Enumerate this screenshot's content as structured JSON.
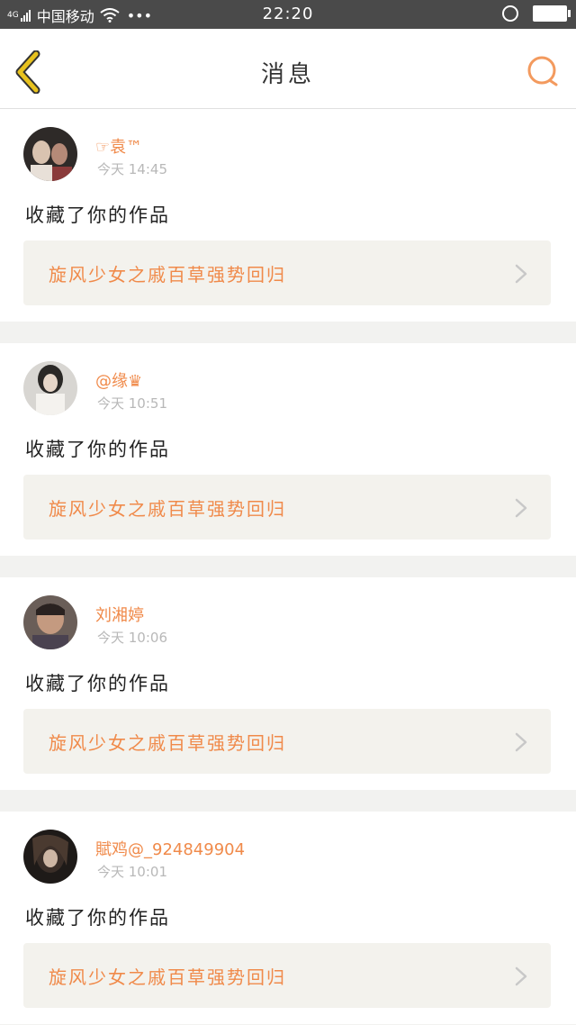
{
  "status_bar": {
    "network": "4G",
    "carrier": "中国移动",
    "more": "•••",
    "time": "22:20"
  },
  "header": {
    "title": "消息"
  },
  "notifications": [
    {
      "username": "☞袁™",
      "time": "今天 14:45",
      "action": "收藏了你的作品",
      "work_title": "旋风少女之戚百草强势回归"
    },
    {
      "username": "@缘♛",
      "time": "今天 10:51",
      "action": "收藏了你的作品",
      "work_title": "旋风少女之戚百草强势回归"
    },
    {
      "username": "刘湘婷",
      "time": "今天 10:06",
      "action": "收藏了你的作品",
      "work_title": "旋风少女之戚百草强势回归"
    },
    {
      "username": "賦鸡@_924849904",
      "time": "今天 10:01",
      "action": "收藏了你的作品",
      "work_title": "旋风少女之戚百草强势回归"
    }
  ],
  "colors": {
    "accent": "#f08a4a",
    "back_arrow": "#e8c21e",
    "status_bar": "#4a4a4a"
  }
}
